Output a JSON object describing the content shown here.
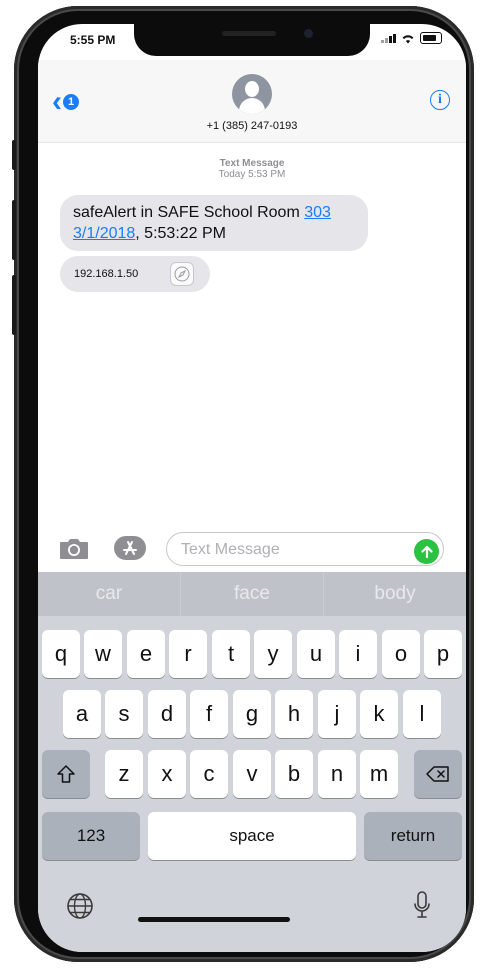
{
  "status_bar": {
    "time": "5:55 PM"
  },
  "header": {
    "back_badge": "1",
    "contact": "+1 (385) 247-0193",
    "info_label": "i"
  },
  "conversation": {
    "meta_title": "Text Message",
    "meta_time": "Today 5:53 PM",
    "message1": {
      "text_a": "safeAlert in SAFE School Room ",
      "link_a": "303",
      "link_b": "3/1/2018",
      "text_b": ", 5:53:22 PM"
    },
    "message2": {
      "text": "192.168.1.50"
    }
  },
  "input": {
    "placeholder": "Text Message"
  },
  "keyboard": {
    "predictions": [
      "car",
      "face",
      "body"
    ],
    "row1": [
      "q",
      "w",
      "e",
      "r",
      "t",
      "y",
      "u",
      "i",
      "o",
      "p"
    ],
    "row2": [
      "a",
      "s",
      "d",
      "f",
      "g",
      "h",
      "j",
      "k",
      "l"
    ],
    "row3": [
      "z",
      "x",
      "c",
      "v",
      "b",
      "n",
      "m"
    ],
    "numbers_label": "123",
    "space_label": "space",
    "return_label": "return"
  },
  "colors": {
    "accent": "#1a7df7",
    "send": "#2bc241",
    "bubble": "#e5e5ea"
  },
  "icons": [
    "back-chevron-icon",
    "info-icon",
    "camera-icon",
    "app-store-icon",
    "send-arrow-icon",
    "compass-icon",
    "shift-icon",
    "delete-icon",
    "globe-icon",
    "microphone-icon"
  ]
}
